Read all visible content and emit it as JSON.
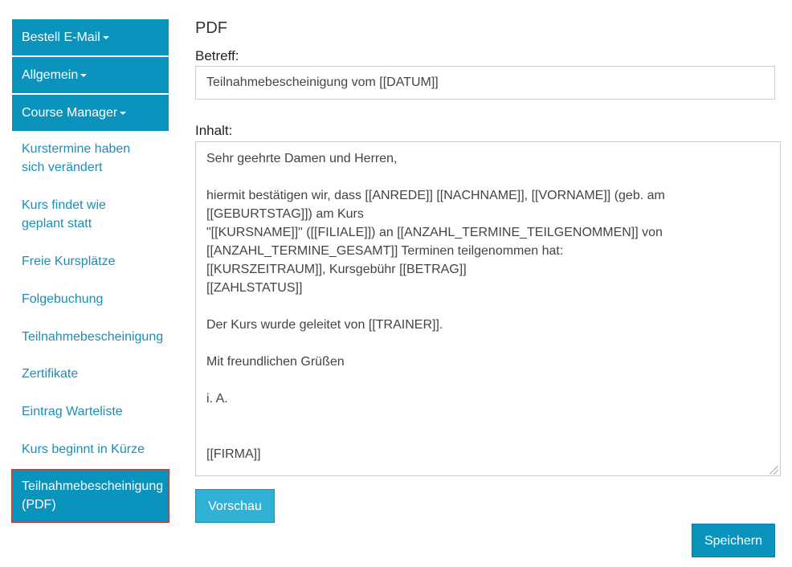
{
  "sidebar": {
    "groups": [
      {
        "label": "Bestell E-Mail"
      },
      {
        "label": "Allgemein"
      },
      {
        "label": "Course Manager"
      }
    ],
    "items": [
      {
        "label": "Kurstermine haben sich verändert"
      },
      {
        "label": "Kurs findet wie geplant statt"
      },
      {
        "label": "Freie Kursplätze"
      },
      {
        "label": "Folgebuchung"
      },
      {
        "label": "Teilnahmebescheinigung"
      },
      {
        "label": "Zertifikate"
      },
      {
        "label": "Eintrag Warteliste"
      },
      {
        "label": "Kurs beginnt in Kürze"
      }
    ],
    "active_item": {
      "label": "Teilnahmebescheinigung (PDF)"
    }
  },
  "main": {
    "section_title": "PDF",
    "subject_label": "Betreff:",
    "subject_value": "Teilnahmebescheinigung vom [[DATUM]]",
    "content_label": "Inhalt:",
    "content_value": "Sehr geehrte Damen und Herren,\n\nhiermit bestätigen wir, dass [[ANREDE]] [[NACHNAME]], [[VORNAME]] (geb. am [[GEBURTSTAG]]) am Kurs\n\"[[KURSNAME]]\" ([[FILIALE]]) an [[ANZAHL_TERMINE_TEILGENOMMEN]] von [[ANZAHL_TERMINE_GESAMT]] Terminen teilgenommen hat:\n[[KURSZEITRAUM]], Kursgebühr [[BETRAG]]\n[[ZAHLSTATUS]]\n\nDer Kurs wurde geleitet von [[TRAINER]].\n\nMit freundlichen Grüßen\n\ni. A.\n\n\n[[FIRMA]]",
    "preview_label": "Vorschau",
    "save_label": "Speichern"
  },
  "colors": {
    "accent": "#0a94bd",
    "link": "#1a8fb5",
    "preview_button": "#30b1d6",
    "active_border": "#c0392b"
  }
}
